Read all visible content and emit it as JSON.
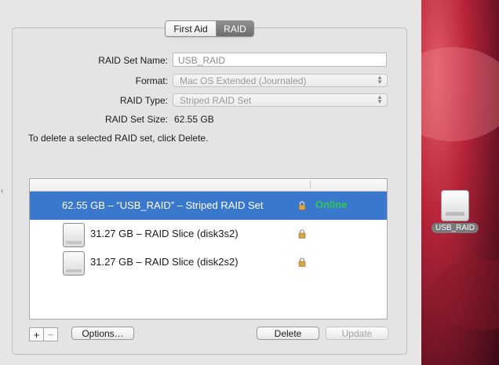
{
  "tabs": [
    {
      "label": "First Aid",
      "selected": false
    },
    {
      "label": "RAID",
      "selected": true
    }
  ],
  "form": {
    "set_name_label": "RAID Set Name:",
    "set_name_value": "USB_RAID",
    "format_label": "Format:",
    "format_value": "Mac OS Extended (Journaled)",
    "type_label": "RAID Type:",
    "type_value": "Striped RAID Set",
    "size_label": "RAID Set Size:",
    "size_value": "62.55 GB"
  },
  "hint": "To delete a selected RAID set, click Delete.",
  "list": {
    "rows": [
      {
        "text": "62.55 GB – “USB_RAID” – Striped RAID Set",
        "status": "Online",
        "selected": true
      },
      {
        "text": "31.27 GB – RAID Slice (disk3s2)",
        "status": "",
        "selected": false
      },
      {
        "text": "31.27 GB – RAID Slice (disk2s2)",
        "status": "",
        "selected": false
      }
    ]
  },
  "buttons": {
    "plus": "+",
    "minus": "−",
    "options": "Options…",
    "delete": "Delete",
    "update": "Update"
  },
  "desktop": {
    "disk_label": "USB_RAID"
  },
  "colors": {
    "selection": "#3a78cd",
    "online": "#34c85a"
  }
}
